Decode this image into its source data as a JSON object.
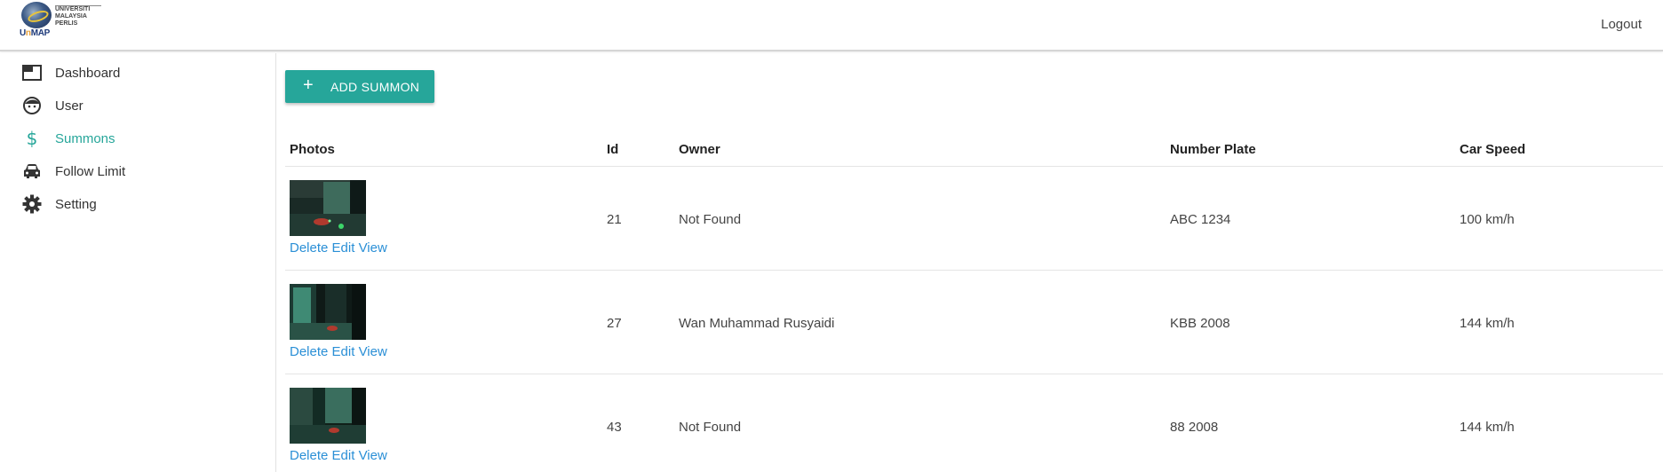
{
  "header": {
    "logo": {
      "seal": "university-seal",
      "word_a": "U",
      "word_b": "n",
      "word_c": "MAP",
      "line1": "UNIVERSITI",
      "line2": "MALAYSIA",
      "line3": "PERLIS"
    },
    "logout_label": "Logout"
  },
  "sidebar": {
    "items": [
      {
        "label": "Dashboard",
        "icon": "dashboard-icon"
      },
      {
        "label": "User",
        "icon": "face-icon"
      },
      {
        "label": "Summons",
        "icon": "dollar-icon",
        "active": true
      },
      {
        "label": "Follow Limit",
        "icon": "car-icon"
      },
      {
        "label": "Setting",
        "icon": "gear-icon"
      }
    ]
  },
  "main": {
    "add_button": {
      "icon": "+",
      "label": "ADD SUMMON"
    },
    "table": {
      "columns": [
        "Photos",
        "Id",
        "Owner",
        "Number Plate",
        "Car Speed"
      ],
      "rows": [
        {
          "id": "21",
          "owner": "Not Found",
          "plate": "ABC 1234",
          "speed": "100 km/h",
          "actions": {
            "delete": "Delete",
            "edit": "Edit",
            "view": "View"
          }
        },
        {
          "id": "27",
          "owner": "Wan Muhammad Rusyaidi",
          "plate": "KBB 2008",
          "speed": "144 km/h",
          "actions": {
            "delete": "Delete",
            "edit": "Edit",
            "view": "View"
          }
        },
        {
          "id": "43",
          "owner": "Not Found",
          "plate": "88 2008",
          "speed": "144 km/h",
          "actions": {
            "delete": "Delete",
            "edit": "Edit",
            "view": "View"
          }
        }
      ]
    }
  },
  "colors": {
    "accent": "#26a69a",
    "link": "#2a8fd6"
  }
}
